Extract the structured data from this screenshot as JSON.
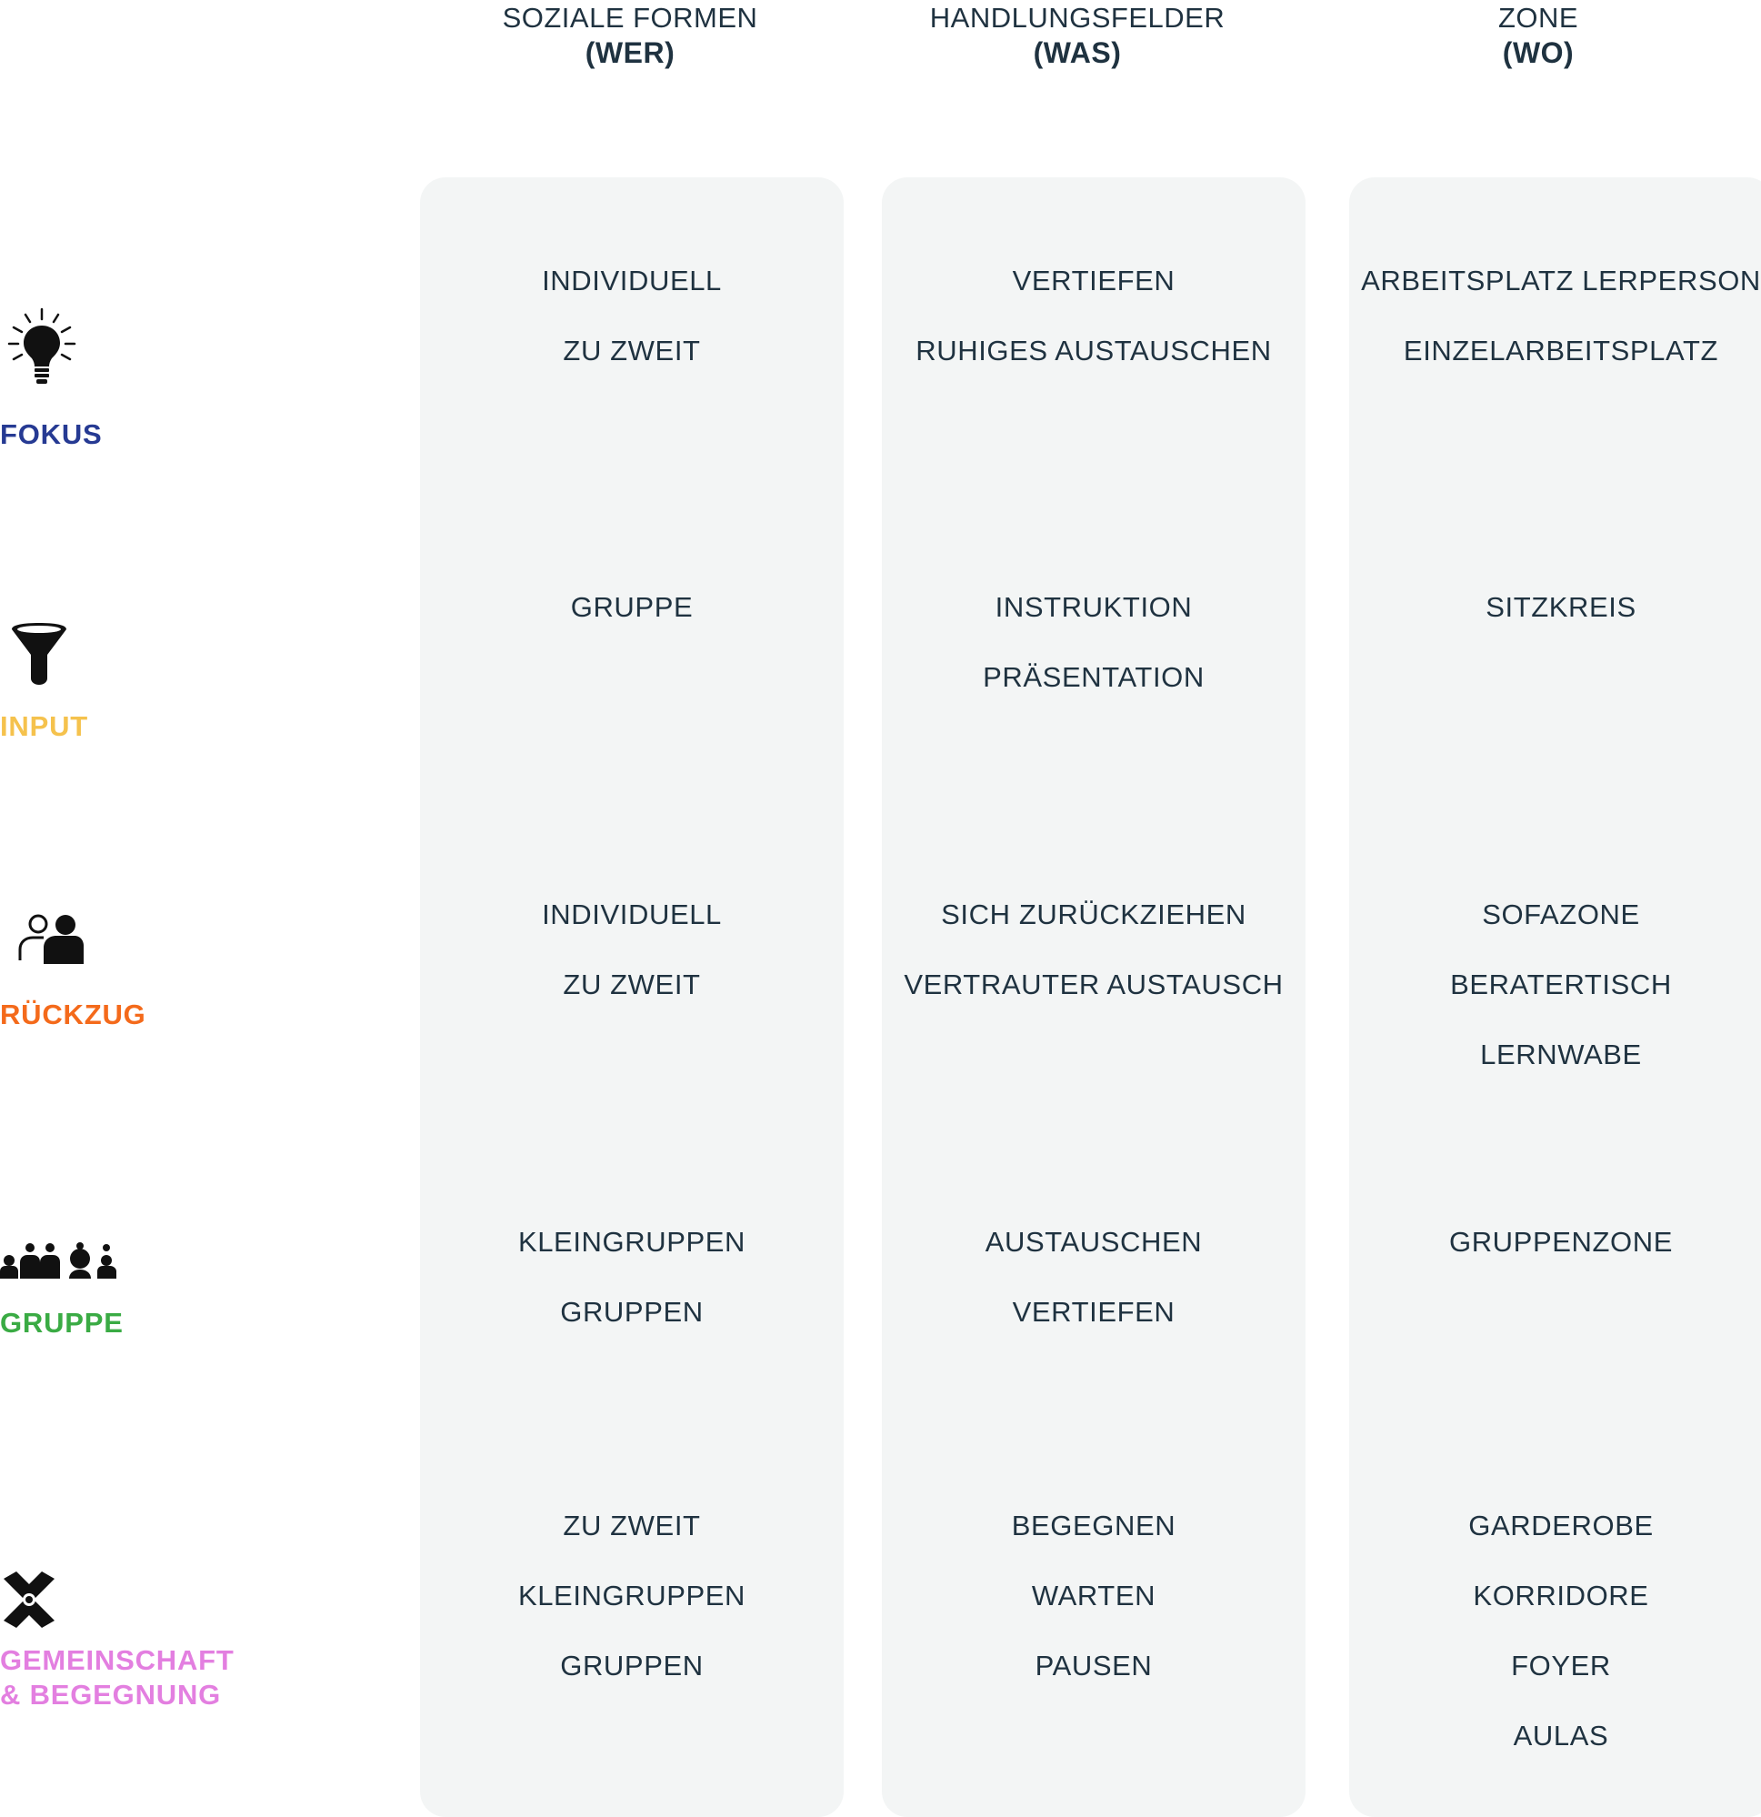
{
  "columns": [
    {
      "title": "SOZIALE FORMEN",
      "subtitle": "(WER)"
    },
    {
      "title": "HANDLUNGSFELDER",
      "subtitle": "(WAS)"
    },
    {
      "title": "ZONE",
      "subtitle": "(WO)"
    }
  ],
  "rows": [
    {
      "label": "FOKUS",
      "color": "#263a93",
      "icon": "lightbulb-icon",
      "cells": [
        [
          "INDIVIDUELL",
          "ZU ZWEIT"
        ],
        [
          "VERTIEFEN",
          "RUHIGES AUSTAUSCHEN"
        ],
        [
          "ARBEITSPLATZ LERPERSON",
          "EINZELARBEITSPLATZ"
        ]
      ]
    },
    {
      "label": "INPUT",
      "color": "#f5c24d",
      "icon": "funnel-icon",
      "cells": [
        [
          "GRUPPE"
        ],
        [
          "INSTRUKTION",
          "PRÄSENTATION"
        ],
        [
          "SITZKREIS"
        ]
      ]
    },
    {
      "label": "RÜCKZUG",
      "color": "#f46a1b",
      "icon": "retreat-people-icon",
      "cells": [
        [
          "INDIVIDUELL",
          "ZU ZWEIT"
        ],
        [
          "SICH ZURÜCKZIEHEN",
          "VERTRAUTER AUSTAUSCH"
        ],
        [
          "SOFAZONE",
          "BERATERTISCH",
          "LERNWABE"
        ]
      ]
    },
    {
      "label": "GRUPPE",
      "color": "#3aab44",
      "icon": "group-people-icon",
      "cells": [
        [
          "KLEINGRUPPEN",
          "GRUPPEN"
        ],
        [
          "AUSTAUSCHEN",
          "VERTIEFEN"
        ],
        [
          "GRUPPENZONE"
        ]
      ]
    },
    {
      "label": "GEMEINSCHAFT\n& BEGEGNUNG",
      "color": "#e37fe0",
      "icon": "joined-hands-icon",
      "cells": [
        [
          "ZU ZWEIT",
          "KLEINGRUPPEN",
          "GRUPPEN"
        ],
        [
          "BEGEGNEN",
          "WARTEN",
          "PAUSEN"
        ],
        [
          "GARDEROBE",
          "KORRIDORE",
          "FOYER",
          "AULAS"
        ]
      ]
    }
  ]
}
